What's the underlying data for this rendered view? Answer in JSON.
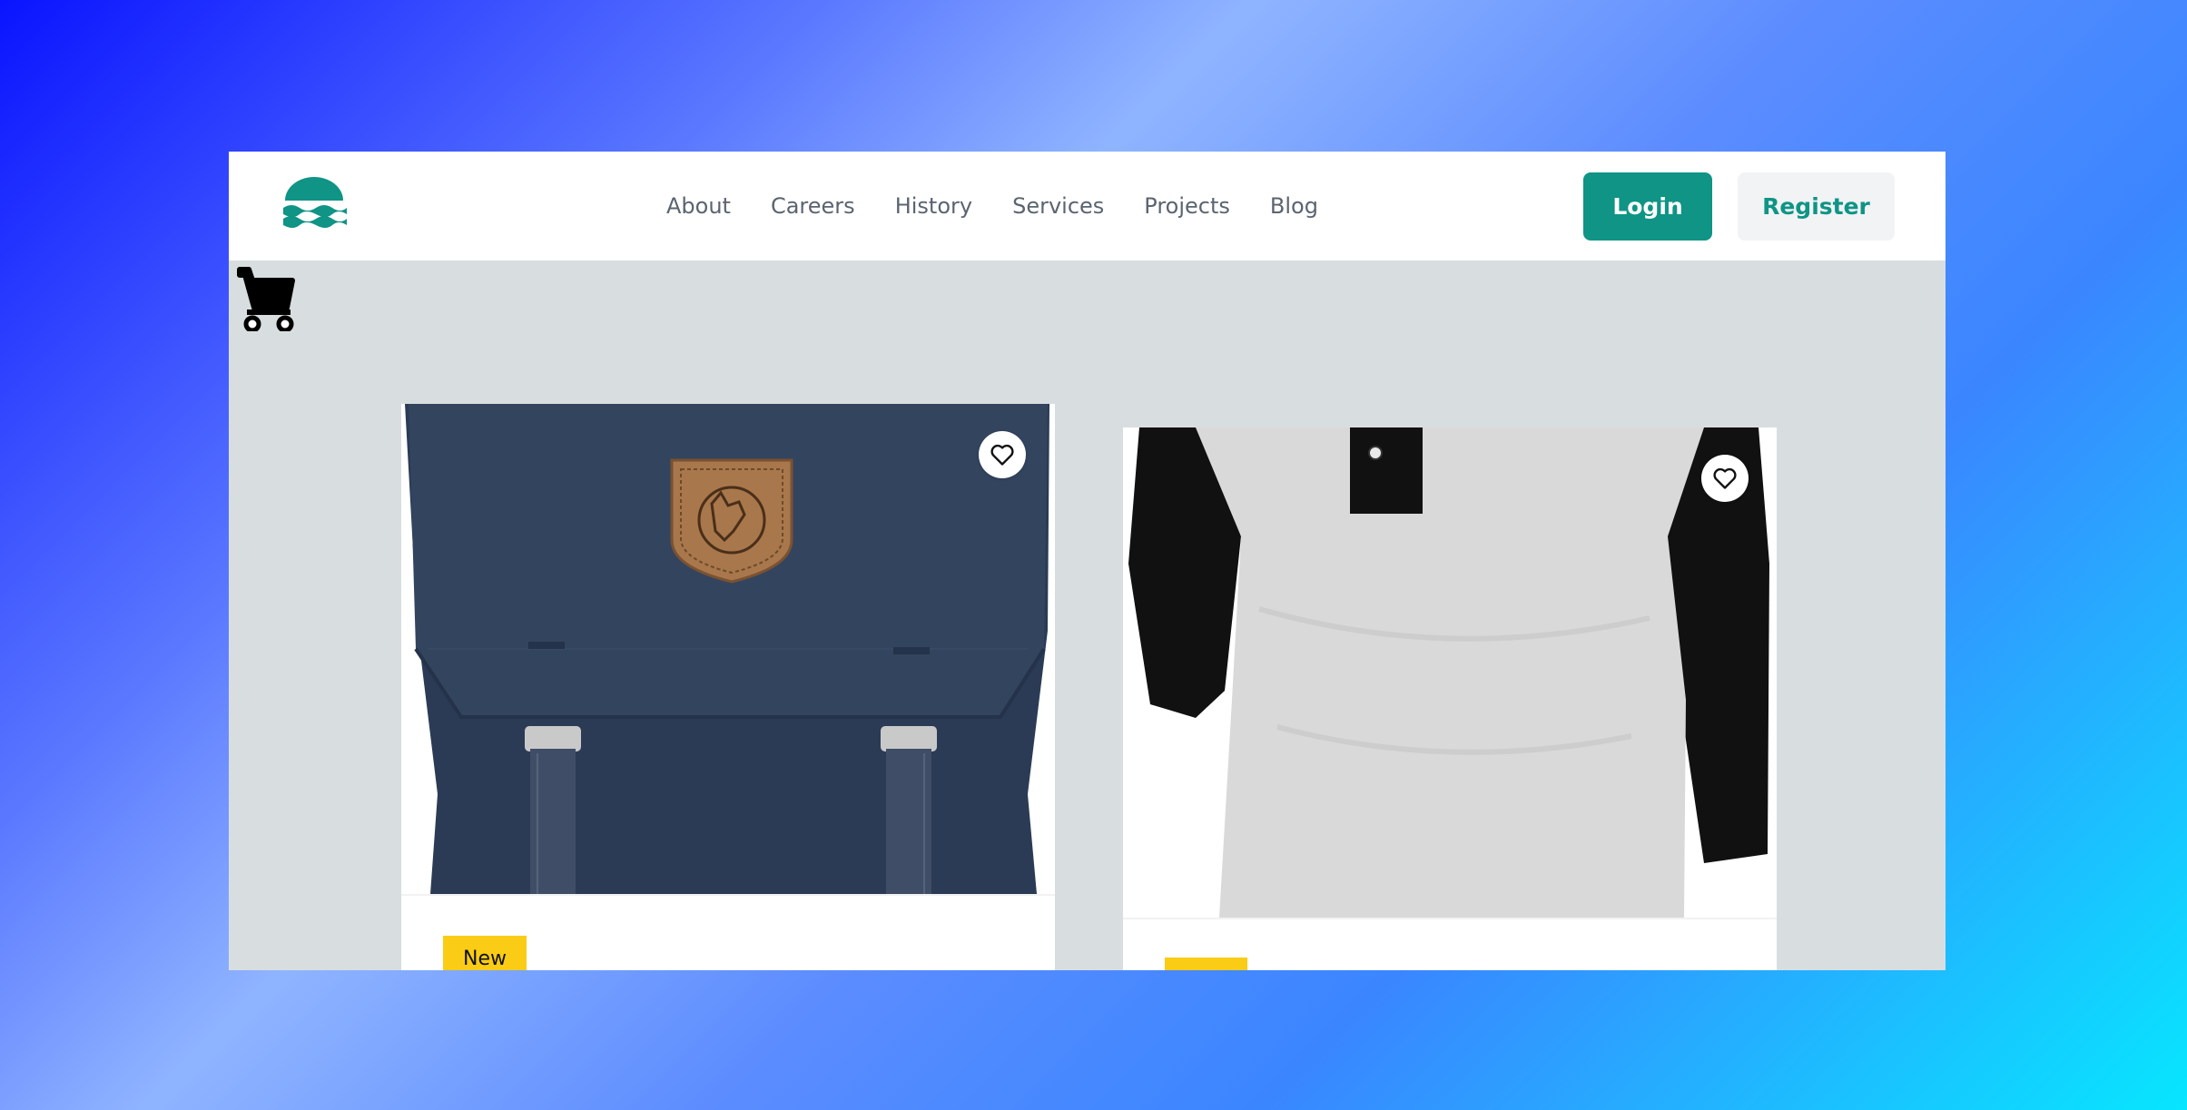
{
  "nav": {
    "links": [
      "About",
      "Careers",
      "History",
      "Services",
      "Projects",
      "Blog"
    ],
    "login_label": "Login",
    "register_label": "Register"
  },
  "icons": {
    "logo": "wave-sun-logo",
    "cart": "shopping-cart-icon",
    "favorite": "heart-icon"
  },
  "colors": {
    "brand": "#0f9486",
    "badge": "#facc15",
    "content_bg": "#d8dedf"
  },
  "products": [
    {
      "image": "navy-backpack-image",
      "badge": "New"
    },
    {
      "image": "raglan-shirt-image",
      "badge": ""
    }
  ]
}
